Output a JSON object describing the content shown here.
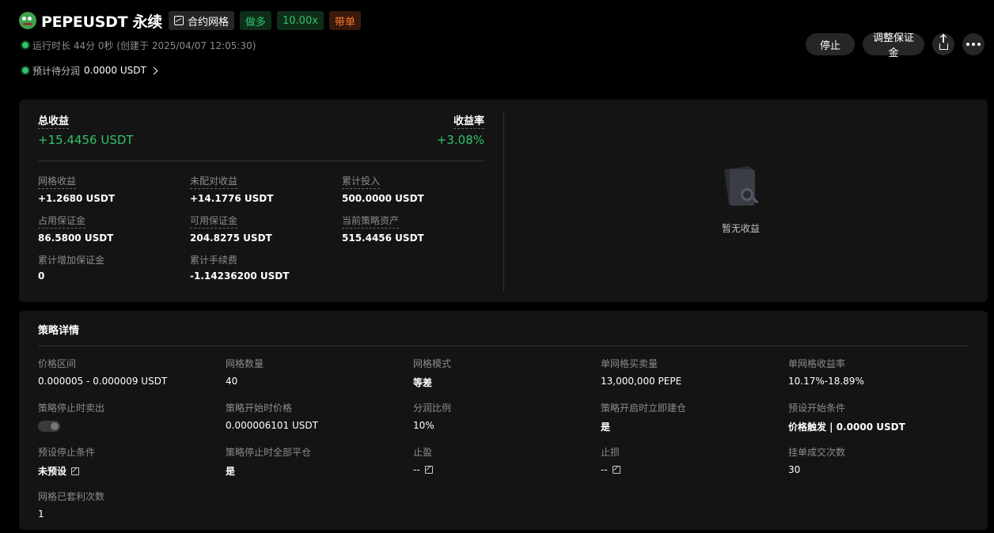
{
  "header": {
    "title": "PEPEUSDT 永续",
    "tags": {
      "grid": "合约网格",
      "direction": "做多",
      "leverage": "10.00x",
      "copy": "带单"
    },
    "runtime": "运行时长 44分 0秒 (创建于 2025/04/07 12:05:30)",
    "expected_profit_label": "预计待分润",
    "expected_profit_value": "0.0000 USDT"
  },
  "actions": {
    "stop": "停止",
    "adjust_margin": "调整保证金"
  },
  "earnings": {
    "total_label": "总收益",
    "total_value": "+15.4456 USDT",
    "rate_label": "收益率",
    "rate_value": "+3.08%",
    "stats": [
      {
        "k": "网格收益",
        "v": "+1.2680 USDT"
      },
      {
        "k": "未配对收益",
        "v": "+14.1776 USDT"
      },
      {
        "k": "累计投入",
        "v": "500.0000 USDT"
      },
      {
        "k": "占用保证金",
        "v": "86.5800 USDT"
      },
      {
        "k": "可用保证金",
        "v": "204.8275 USDT"
      },
      {
        "k": "当前策略资产",
        "v": "515.4456 USDT"
      },
      {
        "k": "累计增加保证金",
        "v": "0"
      },
      {
        "k": "累计手续费",
        "v": "-1.14236200 USDT"
      }
    ],
    "empty_text": "暂无收益"
  },
  "details": {
    "title": "策略详情",
    "items": [
      {
        "k": "价格区间",
        "v": "0.000005 - 0.000009 USDT"
      },
      {
        "k": "网格数量",
        "v": "40"
      },
      {
        "k": "网格模式",
        "v": "等差"
      },
      {
        "k": "单网格买卖量",
        "v": "13,000,000 PEPE"
      },
      {
        "k": "单网格收益率",
        "v": "10.17%-18.89%"
      },
      {
        "k": "策略停止时卖出",
        "v": ""
      },
      {
        "k": "策略开始时价格",
        "v": "0.000006101 USDT"
      },
      {
        "k": "分润比例",
        "v": "10%"
      },
      {
        "k": "策略开启时立即建仓",
        "v": "是"
      },
      {
        "k": "预设开始条件",
        "v": "价格触发 | 0.0000 USDT"
      },
      {
        "k": "预设停止条件",
        "v": "未预设"
      },
      {
        "k": "策略停止时全部平仓",
        "v": "是"
      },
      {
        "k": "止盈",
        "v": "--"
      },
      {
        "k": "止损",
        "v": "--"
      },
      {
        "k": "挂单成交次数",
        "v": "30"
      },
      {
        "k": "网格已套利次数",
        "v": "1"
      }
    ]
  }
}
